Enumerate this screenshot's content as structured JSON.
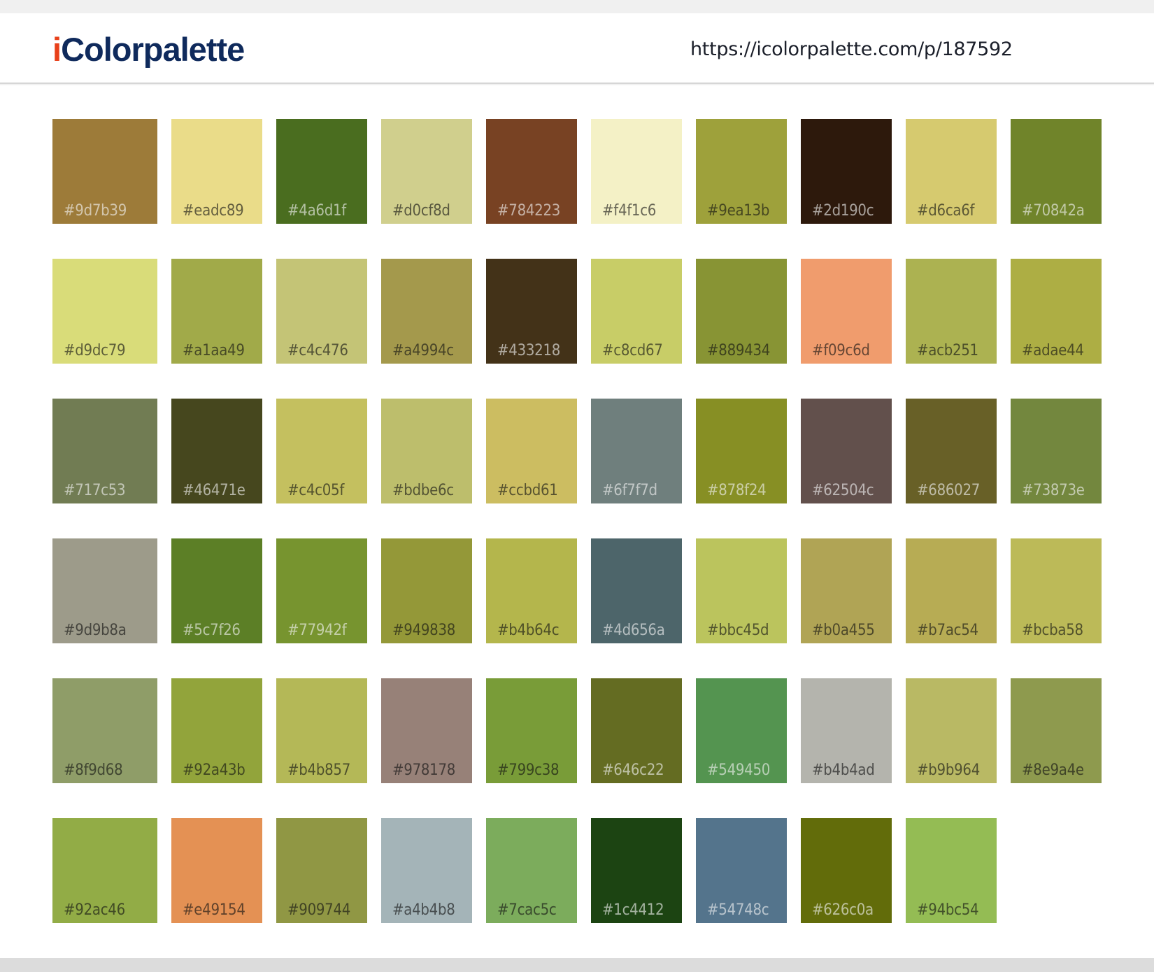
{
  "header": {
    "logo_i": "i",
    "logo_rest": "Colorpalette",
    "url": "https://icolorpalette.com/p/187592"
  },
  "palette": {
    "swatches": [
      {
        "hex": "#9d7b39",
        "label": "#9d7b39",
        "text": "light"
      },
      {
        "hex": "#eadc89",
        "label": "#eadc89",
        "text": "dark"
      },
      {
        "hex": "#4a6d1f",
        "label": "#4a6d1f",
        "text": "light"
      },
      {
        "hex": "#d0cf8d",
        "label": "#d0cf8d",
        "text": "dark"
      },
      {
        "hex": "#784223",
        "label": "#784223",
        "text": "light"
      },
      {
        "hex": "#f4f1c6",
        "label": "#f4f1c6",
        "text": "dark"
      },
      {
        "hex": "#9ea13b",
        "label": "#9ea13b",
        "text": "dark"
      },
      {
        "hex": "#2d190c",
        "label": "#2d190c",
        "text": "light"
      },
      {
        "hex": "#d6ca6f",
        "label": "#d6ca6f",
        "text": "dark"
      },
      {
        "hex": "#70842a",
        "label": "#70842a",
        "text": "light"
      },
      {
        "hex": "#d9dc79",
        "label": "#d9dc79",
        "text": "dark"
      },
      {
        "hex": "#a1aa49",
        "label": "#a1aa49",
        "text": "dark"
      },
      {
        "hex": "#c4c476",
        "label": "#c4c476",
        "text": "dark"
      },
      {
        "hex": "#a4994c",
        "label": "#a4994c",
        "text": "dark"
      },
      {
        "hex": "#433218",
        "label": "#433218",
        "text": "light"
      },
      {
        "hex": "#c8cd67",
        "label": "#c8cd67",
        "text": "dark"
      },
      {
        "hex": "#889434",
        "label": "#889434",
        "text": "dark"
      },
      {
        "hex": "#f09c6d",
        "label": "#f09c6d",
        "text": "dark"
      },
      {
        "hex": "#acb251",
        "label": "#acb251",
        "text": "dark"
      },
      {
        "hex": "#adae44",
        "label": "#adae44",
        "text": "dark"
      },
      {
        "hex": "#717c53",
        "label": "#717c53",
        "text": "light"
      },
      {
        "hex": "#46471e",
        "label": "#46471e",
        "text": "light"
      },
      {
        "hex": "#c4c05f",
        "label": "#c4c05f",
        "text": "dark"
      },
      {
        "hex": "#bdbe6c",
        "label": "#bdbe6c",
        "text": "dark"
      },
      {
        "hex": "#ccbd61",
        "label": "#ccbd61",
        "text": "dark"
      },
      {
        "hex": "#6f7f7d",
        "label": "#6f7f7d",
        "text": "light"
      },
      {
        "hex": "#878f24",
        "label": "#878f24",
        "text": "light"
      },
      {
        "hex": "#62504c",
        "label": "#62504c",
        "text": "light"
      },
      {
        "hex": "#686027",
        "label": "#686027",
        "text": "light"
      },
      {
        "hex": "#73873e",
        "label": "#73873e",
        "text": "light"
      },
      {
        "hex": "#9d9b8a",
        "label": "#9d9b8a",
        "text": "dark"
      },
      {
        "hex": "#5c7f26",
        "label": "#5c7f26",
        "text": "light"
      },
      {
        "hex": "#77942f",
        "label": "#77942f",
        "text": "light"
      },
      {
        "hex": "#949838",
        "label": "#949838",
        "text": "dark"
      },
      {
        "hex": "#b4b64c",
        "label": "#b4b64c",
        "text": "dark"
      },
      {
        "hex": "#4d656a",
        "label": "#4d656a",
        "text": "light"
      },
      {
        "hex": "#bbc45d",
        "label": "#bbc45d",
        "text": "dark"
      },
      {
        "hex": "#b0a455",
        "label": "#b0a455",
        "text": "dark"
      },
      {
        "hex": "#b7ac54",
        "label": "#b7ac54",
        "text": "dark"
      },
      {
        "hex": "#bcba58",
        "label": "#bcba58",
        "text": "dark"
      },
      {
        "hex": "#8f9d68",
        "label": "#8f9d68",
        "text": "dark"
      },
      {
        "hex": "#92a43b",
        "label": "#92a43b",
        "text": "dark"
      },
      {
        "hex": "#b4b857",
        "label": "#b4b857",
        "text": "dark"
      },
      {
        "hex": "#978178",
        "label": "#978178",
        "text": "dark"
      },
      {
        "hex": "#799c38",
        "label": "#799c38",
        "text": "dark"
      },
      {
        "hex": "#646c22",
        "label": "#646c22",
        "text": "light"
      },
      {
        "hex": "#549450",
        "label": "#549450",
        "text": "light"
      },
      {
        "hex": "#b4b4ad",
        "label": "#b4b4ad",
        "text": "dark"
      },
      {
        "hex": "#b9b964",
        "label": "#b9b964",
        "text": "dark"
      },
      {
        "hex": "#8e9a4e",
        "label": "#8e9a4e",
        "text": "dark"
      },
      {
        "hex": "#92ac46",
        "label": "#92ac46",
        "text": "dark"
      },
      {
        "hex": "#e49154",
        "label": "#e49154",
        "text": "dark"
      },
      {
        "hex": "#909744",
        "label": "#909744",
        "text": "dark"
      },
      {
        "hex": "#a4b4b8",
        "label": "#a4b4b8",
        "text": "dark"
      },
      {
        "hex": "#7cac5c",
        "label": "#7cac5c",
        "text": "dark"
      },
      {
        "hex": "#1c4412",
        "label": "#1c4412",
        "text": "light"
      },
      {
        "hex": "#54748c",
        "label": "#54748c",
        "text": "light"
      },
      {
        "hex": "#626c0a",
        "label": "#626c0a",
        "text": "light"
      },
      {
        "hex": "#94bc54",
        "label": "#94bc54",
        "text": "dark"
      }
    ]
  }
}
